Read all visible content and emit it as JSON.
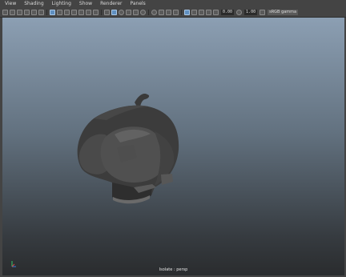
{
  "menu": [
    "View",
    "Shading",
    "Lighting",
    "Show",
    "Renderer",
    "Panels"
  ],
  "toolbar": {
    "field_a": "0.00",
    "field_b": "1.00",
    "color_space_label": "sRGB gamma"
  },
  "viewport": {
    "hud_label": "Isolate : persp",
    "background_top": "#8c9fb3",
    "background_bottom": "#2a2c2e"
  }
}
